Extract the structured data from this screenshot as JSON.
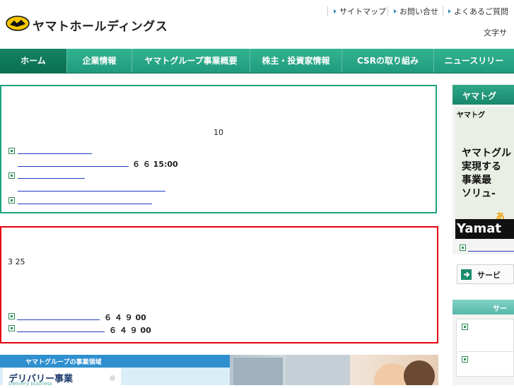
{
  "header": {
    "logo_text": "ヤマトホールディングス",
    "utility_links": [
      "サイトマップ",
      "お問い合せ",
      "よくあるご質問"
    ],
    "text_size_label": "文字サ"
  },
  "nav": {
    "items": [
      "ホーム",
      "企業情報",
      "ヤマトグループ事業概要",
      "株主・投資家情報",
      "CSRの取り組み",
      "ニュースリリー"
    ]
  },
  "green_box": {
    "count_text": "10",
    "news_date_1": "６ ６ 15:00"
  },
  "red_box": {
    "date_text": "3 25",
    "item_1_date": "６ ４ ９ 00",
    "item_2_date": "６ ４ ９ 00"
  },
  "banner": {
    "title": "ヤマトグループの事業領域",
    "delivery_label": "デリバリー事業",
    "delivery_sub": "Delivery business"
  },
  "sidebar": {
    "header": "ヤマトグ",
    "ad_logo": "ヤマトグ",
    "ad_copy": "ヤマトグル\n実現する\n事業最\nソリュ-",
    "ad_accent": "あ",
    "ad_brand": "Yamat",
    "service_label": "サービ",
    "second_header": "サー"
  },
  "colors": {
    "nav_green": "#1f9d7e",
    "green_box_border": "#1aa37f",
    "red_box_border": "#e60012",
    "link_blue": "#1d3fbf"
  }
}
